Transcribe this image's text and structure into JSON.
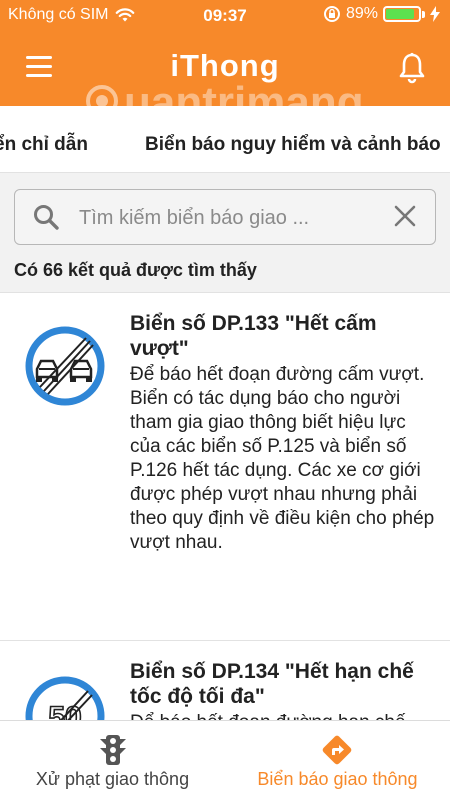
{
  "status_bar": {
    "carrier": "Không có SIM",
    "time": "09:37",
    "battery_percent": "89%",
    "battery_level": 0.89,
    "wifi_icon": "wifi-icon",
    "rotation_lock_icon": "rotation-lock-icon",
    "charging_icon": "charging-bolt-icon"
  },
  "app_bar": {
    "title": "iThong",
    "menu_icon": "hamburger-menu-icon",
    "bell_icon": "bell-icon"
  },
  "watermark": "uantrimang",
  "tabs": [
    {
      "label": "ển chỉ dẫn"
    },
    {
      "label": "Biển báo nguy hiểm và cảnh báo"
    }
  ],
  "search": {
    "placeholder": "Tìm kiếm biển báo giao ...",
    "value": ""
  },
  "results_text": "Có 66 kết quả được tìm thấy",
  "items": [
    {
      "title": "Biển số DP.133 \"Hết cấm vượt\"",
      "description": "Để báo hết đoạn đường cấm vượt.\nBiển có tác dụng báo cho người tham gia giao thông biết hiệu lực của các biển số P.125 và biển số P.126 hết tác dụng. Các xe cơ giới được phép vượt nhau nhưng phải theo quy định về điều kiện cho phép vượt nhau.",
      "sign": "end-of-no-overtaking-sign"
    },
    {
      "title": "Biển số DP.134 \"Hết hạn chế tốc độ tối đa\"",
      "description": "Để báo hết đoạn đường hạn chế",
      "sign": "end-of-speed-limit-sign",
      "sign_number": "50"
    }
  ],
  "bottom_nav": [
    {
      "label": "Xử phạt giao thông",
      "icon": "traffic-light-icon",
      "active": false
    },
    {
      "label": "Biển báo giao thông",
      "icon": "direction-sign-icon",
      "active": true
    }
  ],
  "colors": {
    "accent": "#f7892a",
    "sign_ring": "#2f86d6",
    "text": "#222222",
    "inactive_nav": "#444444"
  }
}
